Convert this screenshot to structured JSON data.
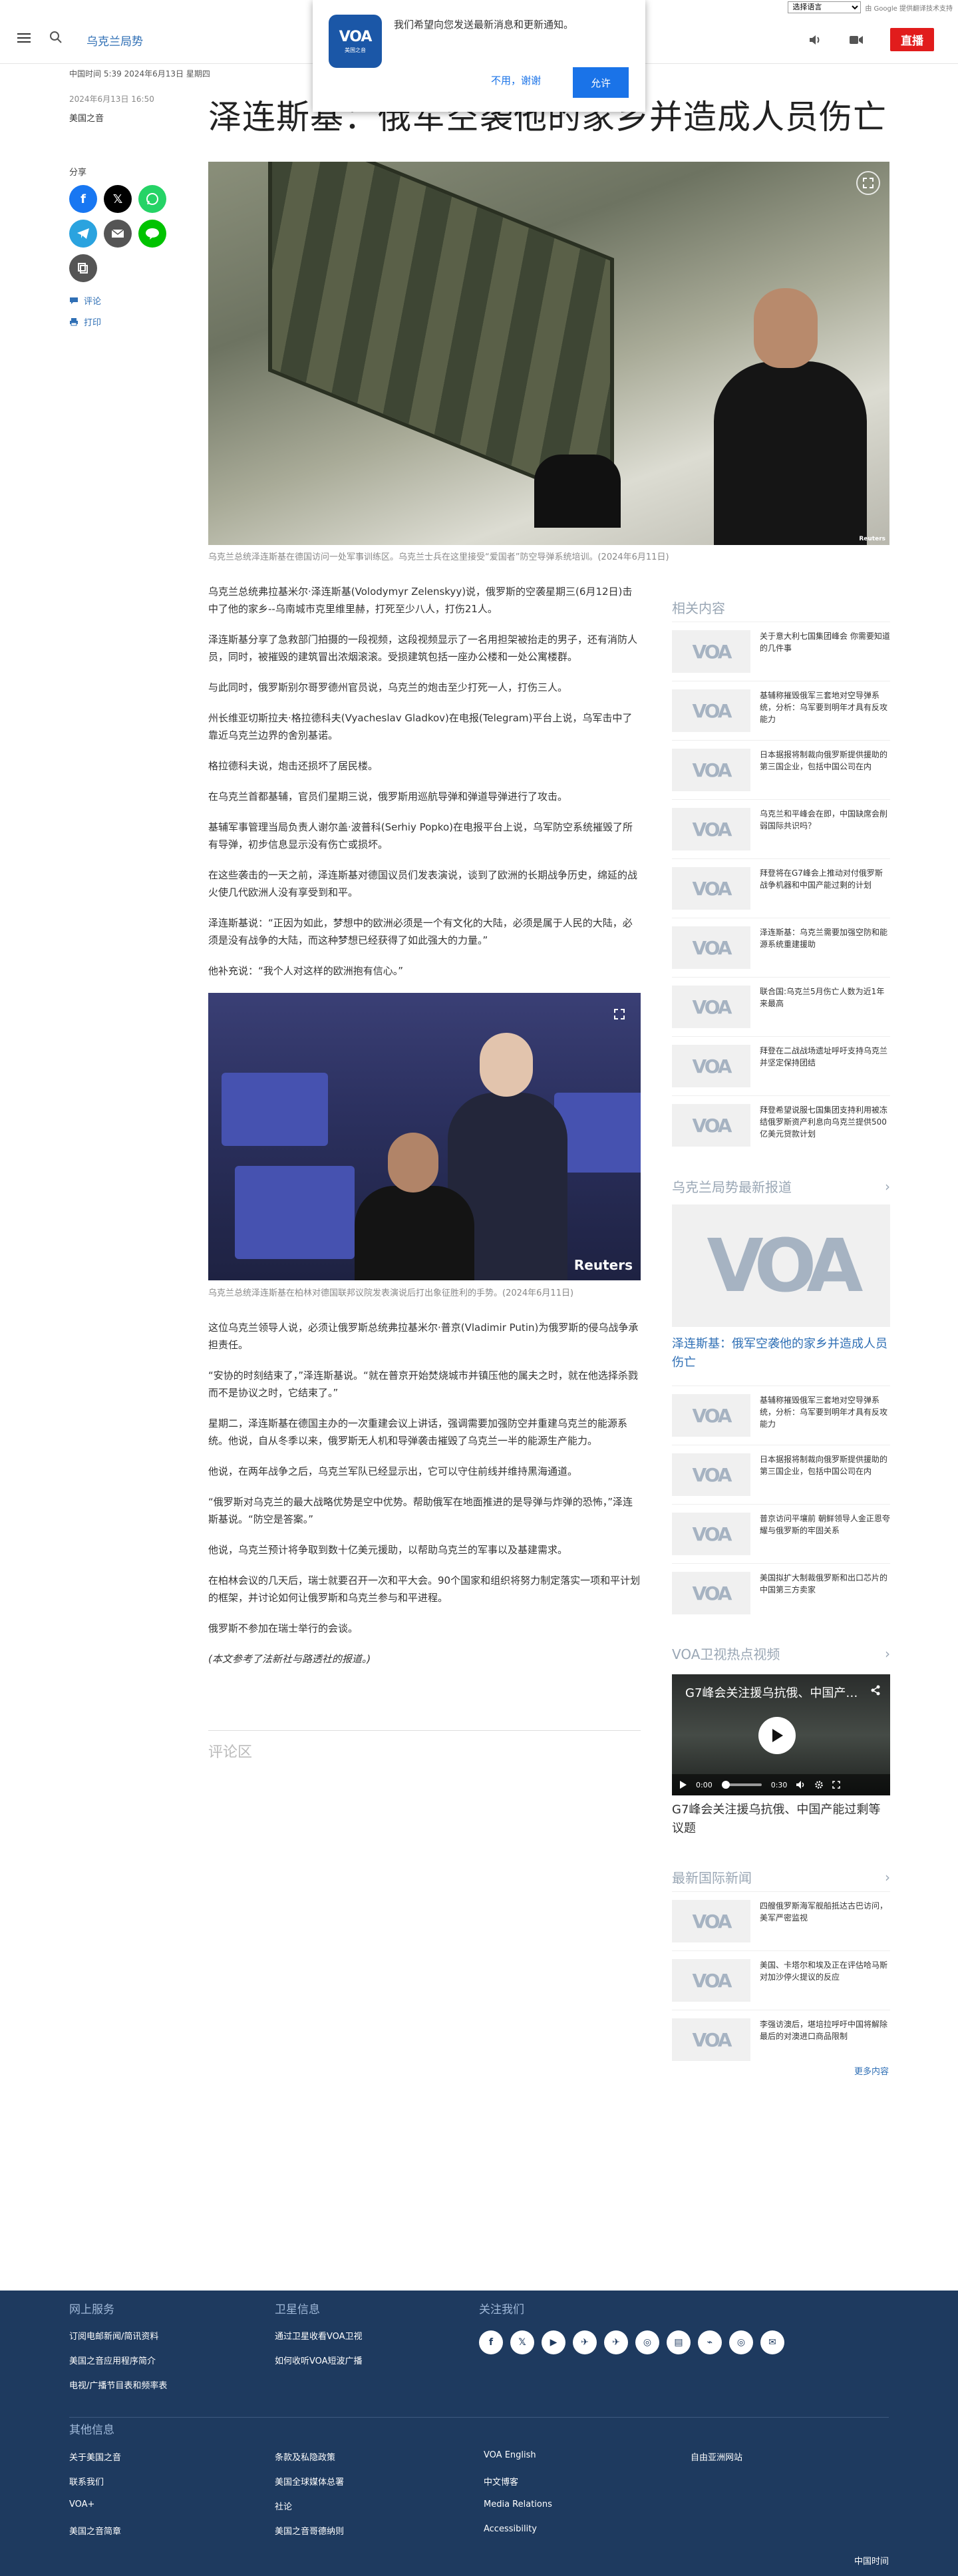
{
  "translate": {
    "select_label": "选择语言",
    "powered_by": "由 Google 提供翻译技术支持"
  },
  "header": {
    "section": "乌克兰局势",
    "live": "直播"
  },
  "notification": {
    "logo_text": "VOA",
    "logo_sub": "美国之音",
    "message": "我们希望向您发送最新消息和更新通知。",
    "decline": "不用，谢谢",
    "allow": "允许"
  },
  "meta": {
    "time_line": "中国时间 5:39 2024年6月13日 星期四",
    "updated": "2024年6月13日 16:50",
    "author": "美国之音"
  },
  "headline": "泽连斯基：俄军空袭他的家乡并造成人员伤亡",
  "share": {
    "label": "分享",
    "comments": "评论",
    "print": "打印"
  },
  "hero": {
    "credit": "Reuters",
    "caption": "乌克兰总统泽连斯基在德国访问一处军事训练区。乌克兰士兵在这里接受“爱国者”防空导弹系统培训。(2024年6月11日)"
  },
  "article": {
    "paragraphs_a": [
      "乌克兰总统弗拉基米尔·泽连斯基(Volodymyr Zelenskyy)说，俄罗斯的空袭星期三(6月12日)击中了他的家乡--乌南城市克里维里赫，打死至少八人，打伤21人。",
      "泽连斯基分享了急救部门拍摄的一段视频，这段视频显示了一名用担架被抬走的男子，还有消防人员，同时，被摧毁的建筑冒出浓烟滚滚。受损建筑包括一座办公楼和一处公寓楼群。",
      "与此同时，俄罗斯别尔哥罗德州官员说，乌克兰的炮击至少打死一人，打伤三人。",
      "州长维亚切斯拉夫·格拉德科夫(Vyacheslav Gladkov)在电报(Telegram)平台上说，乌军击中了靠近乌克兰边界的舍別基诺。",
      "格拉德科夫说，炮击还损坏了居民楼。",
      "在乌克兰首都基辅，官员们星期三说，俄罗斯用巡航导弹和弹道导弹进行了攻击。",
      "基辅军事管理当局负责人谢尔盖·波普科(Serhiy Popko)在电报平台上说，乌军防空系统摧毁了所有导弹，初步信息显示没有伤亡或损坏。",
      "在这些袭击的一天之前，泽连斯基对德国议员们发表演说，谈到了欧洲的长期战争历史，绵延的战火使几代欧洲人没有享受到和平。",
      "泽连斯基说：“正因为如此，梦想中的欧洲必须是一个有文化的大陆，必须是属于人民的大陆，必须是没有战争的大陆，而这种梦想已经获得了如此强大的力量。”",
      "他补充说：“我个人对这样的欧洲抱有信心。”"
    ],
    "inline_credit": "Reuters",
    "inline_caption": "乌克兰总统泽连斯基在柏林对德国联邦议院发表演说后打出象征胜利的手势。(2024年6月11日)",
    "paragraphs_b": [
      "这位乌克兰领导人说，必须让俄罗斯总统弗拉基米尔·普京(Vladimir Putin)为俄罗斯的侵乌战争承担责任。",
      "“安协的时刻结束了，”泽连斯基说。“就在普京开始焚烧城市并镇压他的属夫之时，就在他选择杀戮而不是协议之时，它结束了。”",
      "星期二，泽连斯基在德国主办的一次重建会议上讲话，强调需要加强防空并重建乌克兰的能源系统。他说，自从冬季以来，俄罗斯无人机和导弹袭击摧毁了乌克兰一半的能源生产能力。",
      "他说，在两年战争之后，乌克兰军队已经显示出，它可以守住前线并维持黑海通道。",
      "“俄罗斯对乌克兰的最大战略优势是空中优势。帮助俄军在地面推进的是导弹与炸弹的恐怖，”泽连斯基说。“防空是答案。”",
      "他说，乌克兰预计将争取到数十亿美元援助，以帮助乌克兰的军事以及基建需求。",
      "在柏林会议的几天后，瑞士就要召开一次和平大会。90个国家和组织将努力制定落实一项和平计划的框架，并讨论如何让俄罗斯和乌克兰参与和平进程。",
      "俄罗斯不参加在瑞士举行的会谈。"
    ],
    "source_note": "(本文参考了法新社与路透社的报道。)"
  },
  "comments_title": "评论区",
  "sidebar": {
    "related_title": "相关内容",
    "related": [
      "关于意大利七国集团峰会 你需要知道的几件事",
      "基辅称摧毁俄军三套地对空导弹系统，分析：乌军要到明年才具有反攻能力",
      "日本据报将制裁向俄罗斯提供援助的第三国企业，包括中国公司在内",
      "乌克兰和平峰会在即，中国缺席会削弱国际共识吗？",
      "拜登将在G7峰会上推动对付俄罗斯战争机器和中国产能过剩的计划",
      "泽连斯基：乌克兰需要加强空防和能源系统重建援助",
      "联合国:乌克兰5月伤亡人数为近1年来最高",
      "拜登在二战战场遗址呼吁支持乌克兰并坚定保持团结",
      "拜登希望说服七国集团支持利用被冻结俄罗斯资产利息向乌克兰提供500亿美元贷款计划"
    ],
    "latest_title": "乌克兰局势最新报道",
    "feature_title": "泽连斯基：俄军空袭他的家乡并造成人员伤亡",
    "latest": [
      "基辅称摧毁俄军三套地对空导弹系统，分析：乌军要到明年才具有反攻能力",
      "日本据报将制裁向俄罗斯提供援助的第三国企业，包括中国公司在内",
      "普京访问平壤前 朝鲜领导人金正恩夸耀与俄罗斯的牢固关系",
      "美国拟扩大制裁俄罗斯和出口芯片的中国第三方卖家"
    ],
    "video_title": "VOA卫视热点视频",
    "video": {
      "title": "G7峰会关注援乌抗俄、中国产能过剩等...",
      "time_now": "0:00",
      "time_total": "0:30",
      "caption": "G7峰会关注援乌抗俄、中国产能过剩等议题"
    },
    "intl_title": "最新国际新闻",
    "intl": [
      "四艘俄罗斯海军舰船抵达古巴访问，美军严密监视",
      "美国、卡塔尔和埃及正在评估哈马斯对加沙停火提议的反应",
      "李强访澳后，堪培拉呼吁中国将解除最后的对澳进口商品限制"
    ],
    "more": "更多内容"
  },
  "footer": {
    "col1_title": "网上服务",
    "col1": [
      "订阅电邮新闻/简讯资料",
      "美国之音应用程序简介",
      "电视/广播节目表和频率表"
    ],
    "col2_title": "卫星信息",
    "col2": [
      "通过卫星收看VOA卫视",
      "如何收听VOA短波广播"
    ],
    "col3_title": "关注我们",
    "social": [
      "f",
      "𝕏",
      "▶",
      "✈",
      "✈",
      "◎",
      "▤",
      "⌁",
      "◎",
      "✉"
    ],
    "other_title": "其他信息",
    "other": [
      [
        "关于美国之音",
        "联系我们",
        "VOA+",
        "美国之音简章"
      ],
      [
        "条款及私隐政策",
        "美国全球媒体总署",
        "社论",
        "美国之音哥德纳则"
      ],
      [
        "VOA English",
        "中文博客",
        "Media Relations",
        "Accessibility"
      ],
      [
        "自由亚洲网站"
      ]
    ],
    "time": "中国时间"
  },
  "colors": {
    "accent": "#2f6fb5",
    "live": "#e11c1c",
    "footer_bg": "#1e3a5f",
    "facebook": "#1877f2",
    "x": "#000000",
    "whatsapp": "#25d366",
    "telegram": "#2aa3df",
    "email": "#555555",
    "line": "#00c300",
    "copy": "#555555"
  }
}
